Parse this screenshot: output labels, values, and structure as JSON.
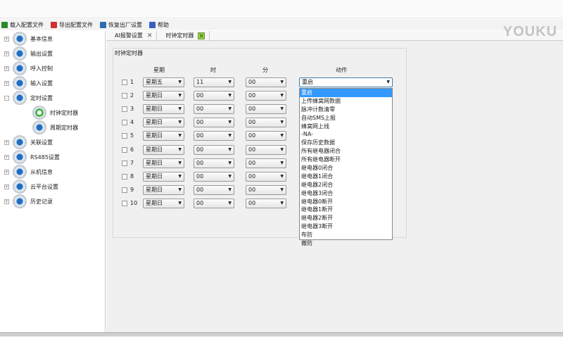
{
  "watermark": "YOUKU",
  "toolbar": [
    {
      "label": "载入配置文件",
      "icon": "load-icon",
      "color": "#2a8a2a"
    },
    {
      "label": "导出配置文件",
      "icon": "export-icon",
      "color": "#d03030"
    },
    {
      "label": "恢复出厂设置",
      "icon": "restore-icon",
      "color": "#2e6db3"
    },
    {
      "label": "帮助",
      "icon": "help-icon",
      "color": "#3a5fc0"
    }
  ],
  "tree": [
    {
      "label": "基本信息",
      "exp": "+"
    },
    {
      "label": "输出设置",
      "exp": "+"
    },
    {
      "label": "呼入控制",
      "exp": "+"
    },
    {
      "label": "输入设置",
      "exp": "+"
    },
    {
      "label": "定时设置",
      "exp": "-"
    },
    {
      "label": "时钟定时器",
      "child": true,
      "active": true
    },
    {
      "label": "周期定时器",
      "child": true
    },
    {
      "label": "关联设置",
      "exp": "+"
    },
    {
      "label": "RS485设置",
      "exp": "+"
    },
    {
      "label": "从机信息",
      "exp": "+"
    },
    {
      "label": "云平台设置",
      "exp": "+"
    },
    {
      "label": "历史记录",
      "exp": "+"
    }
  ],
  "tabs": [
    {
      "label": "AI报警设置"
    },
    {
      "label": "时钟定时器",
      "active": true
    }
  ],
  "group_title": "时钟定时器",
  "headers": {
    "week": "星期",
    "hour": "时",
    "minute": "分",
    "action": "动作"
  },
  "rows": [
    {
      "n": "1",
      "week": "星期五",
      "hour": "11",
      "minute": "00",
      "action": "重启"
    },
    {
      "n": "2",
      "week": "星期日",
      "hour": "00",
      "minute": "00"
    },
    {
      "n": "3",
      "week": "星期日",
      "hour": "00",
      "minute": "00"
    },
    {
      "n": "4",
      "week": "星期日",
      "hour": "00",
      "minute": "00"
    },
    {
      "n": "5",
      "week": "星期日",
      "hour": "00",
      "minute": "00"
    },
    {
      "n": "6",
      "week": "星期日",
      "hour": "00",
      "minute": "00"
    },
    {
      "n": "7",
      "week": "星期日",
      "hour": "00",
      "minute": "00"
    },
    {
      "n": "8",
      "week": "星期日",
      "hour": "00",
      "minute": "00"
    },
    {
      "n": "9",
      "week": "星期日",
      "hour": "00",
      "minute": "00"
    },
    {
      "n": "10",
      "week": "星期日",
      "hour": "00",
      "minute": "00"
    }
  ],
  "action_options": [
    "重启",
    "上传蜂窝网数据",
    "脉冲计数清零",
    "自动SMS上报",
    "蜂窝网上线",
    "-NA-",
    "保存历史数据",
    "所有继电器闭合",
    "所有继电器断开",
    "继电器0闭合",
    "继电器1闭合",
    "继电器2闭合",
    "继电器3闭合",
    "继电器0断开",
    "继电器1断开",
    "继电器2断开",
    "继电器3断开",
    "布防",
    "撤防"
  ],
  "selected_action_index": 0
}
